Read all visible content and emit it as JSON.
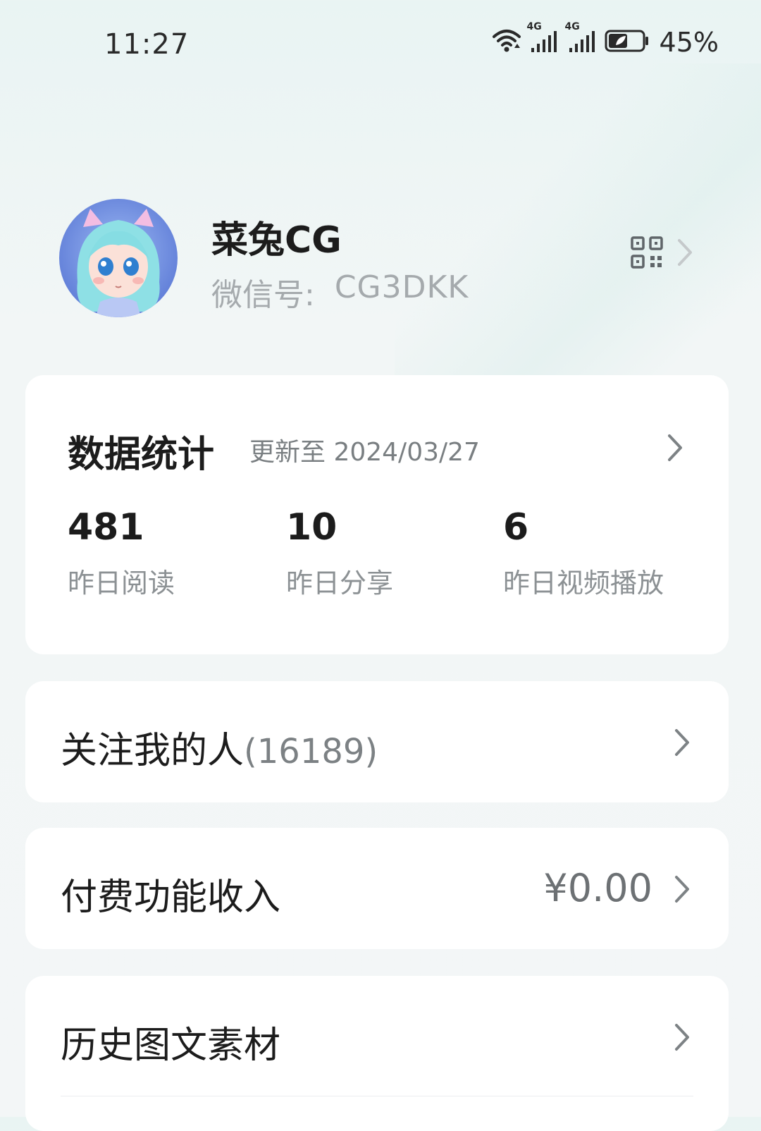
{
  "status_bar": {
    "time": "11:27",
    "battery_percent": "45%",
    "network_badges": [
      "4G",
      "4G"
    ],
    "icons": [
      "wifi-icon",
      "signal-icon",
      "signal-icon",
      "battery-icon"
    ]
  },
  "profile": {
    "name": "菜兔CG",
    "wechat_label": "微信号:",
    "wechat_id": "CG3DKK",
    "qr_icon": "qr-code-icon"
  },
  "stats": {
    "title": "数据统计",
    "updated": "更新至 2024/03/27",
    "items": [
      {
        "value": "481",
        "label": "昨日阅读"
      },
      {
        "value": "10",
        "label": "昨日分享"
      },
      {
        "value": "6",
        "label": "昨日视频播放"
      }
    ]
  },
  "followers": {
    "label": "关注我的人",
    "count": "(16189)"
  },
  "income": {
    "label": "付费功能收入",
    "value": "¥0.00"
  },
  "history": {
    "label": "历史图文素材"
  },
  "colors": {
    "background_top": "#e9f4f3",
    "card": "#ffffff",
    "primary_text": "#1c1c1c",
    "secondary_text": "#a5aaad"
  }
}
